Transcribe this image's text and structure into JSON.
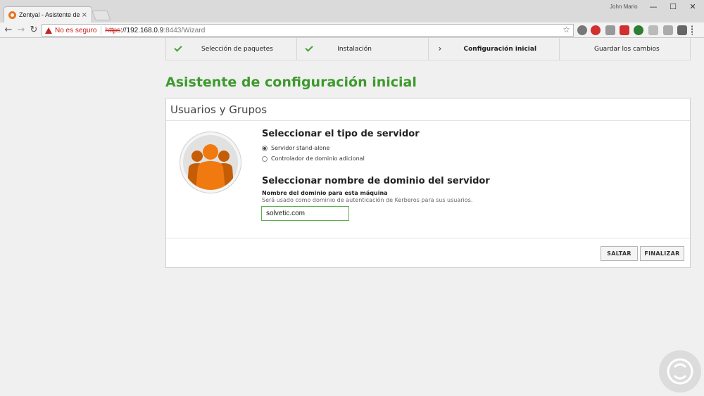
{
  "browser": {
    "tab_title": "Zentyal - Asistente de co",
    "tab_close": "×",
    "user": "John Mario",
    "security_label": "No es seguro",
    "url_protocol": "https",
    "url_host": "://192.168.0.9",
    "url_path": ":8443/Wizard",
    "window_minimize": "—",
    "window_maximize": "☐",
    "window_close": "✕",
    "back": "←",
    "forward": "→",
    "reload": "↻",
    "star": "☆"
  },
  "steps": [
    {
      "label": "Selección de paquetes",
      "state": "done"
    },
    {
      "label": "Instalación",
      "state": "done"
    },
    {
      "label": "Configuración inicial",
      "state": "current"
    },
    {
      "label": "Guardar los cambios",
      "state": "pending"
    }
  ],
  "page": {
    "title": "Asistente de configuración inicial",
    "panel_title": "Usuarios y Grupos"
  },
  "server_type": {
    "title": "Seleccionar el tipo de servidor",
    "options": [
      "Servidor stand-alone",
      "Controlador de dominio adicional"
    ],
    "selected": 0
  },
  "domain": {
    "title": "Seleccionar nombre de dominio del servidor",
    "label": "Nombre del dominio para esta máquina",
    "help": "Será usado como dominio de autenticación de Kerberos para sus usuarios.",
    "value": "solvetic.com"
  },
  "buttons": {
    "skip": "SALTAR",
    "finish": "FINALIZAR"
  },
  "colors": {
    "accent_green": "#3e9a2e",
    "check_green": "#46a035",
    "avatar_orange": "#f07a10",
    "avatar_dark": "#c45d06",
    "warning_red": "#c5221f"
  }
}
